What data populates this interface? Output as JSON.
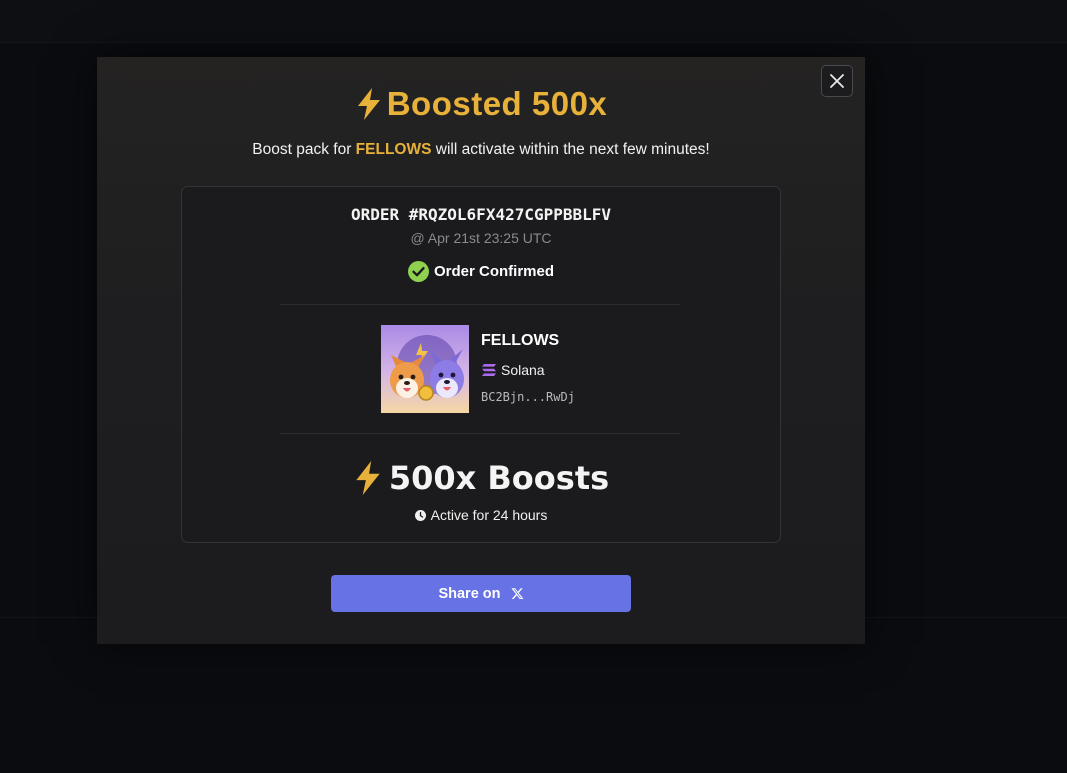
{
  "modal": {
    "title": "Boosted 500x",
    "subtitle_prefix": "Boost pack for ",
    "subtitle_token": "FELLOWS",
    "subtitle_suffix": " will activate within the next few minutes!",
    "close_label": "close"
  },
  "order": {
    "id": "ORDER #RQZOL6FX427CGPPBBLFV",
    "time": "@ Apr 21st 23:25 UTC",
    "status": "Order Confirmed",
    "status_color": "#8fd14f"
  },
  "token": {
    "name": "FELLOWS",
    "chain": "Solana",
    "address": "BC2Bjn...RwDj",
    "image_icon": "fellows-token-avatar"
  },
  "boost": {
    "label": "500x Boosts",
    "duration": "Active for 24 hours"
  },
  "share": {
    "label": "Share on",
    "icon": "x-logo-icon"
  },
  "colors": {
    "accent": "#e8b23a",
    "button": "#6772e5"
  }
}
